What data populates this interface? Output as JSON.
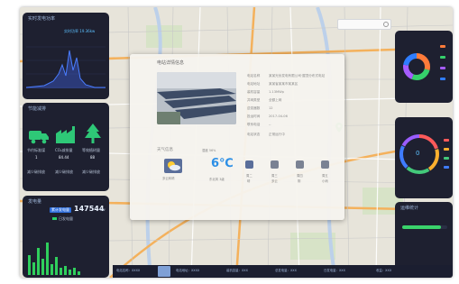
{
  "header": {
    "time": "19:36",
    "year_label": "2024"
  },
  "left_top": {
    "title": "实时发电功率",
    "value_label": "实时功率 19.36kw"
  },
  "left_middle": {
    "title": "节能减排",
    "items": [
      {
        "label": "节约标准煤",
        "value": "1",
        "sub": "减少碳排放"
      },
      {
        "label": "CO₂减排量",
        "value": "84.44",
        "sub": "减少碳排放"
      },
      {
        "label": "等效植树量",
        "value": "88",
        "sub": "减少碳排放"
      }
    ]
  },
  "left_bottom": {
    "title": "发电量",
    "badge": "累计发电量",
    "value": "147544",
    "unit": "kw",
    "legend": "日发电量"
  },
  "popup": {
    "title": "电站详情信息",
    "info": [
      {
        "label": "电站名称",
        "value": "某某光伏发电有限公司·屋顶分布式电站"
      },
      {
        "label": "电站地址",
        "value": "某某省某某市某某区"
      },
      {
        "label": "装机容量",
        "value": "1.13MWp"
      },
      {
        "label": "并网类型",
        "value": "全额上网"
      },
      {
        "label": "逆变器数",
        "value": "12"
      },
      {
        "label": "投运时间",
        "value": "2017-04-06"
      },
      {
        "label": "联系电话",
        "value": "--"
      },
      {
        "label": "电站状态",
        "value": "正常运行中"
      }
    ],
    "weather_title": "天气信息",
    "weather_city": "多云转晴",
    "temperature": "6℃",
    "humidity": "湿度 56%",
    "wind": "东北风 3级",
    "forecast": [
      {
        "day": "周二",
        "desc": "晴"
      },
      {
        "day": "周三",
        "desc": "多云"
      },
      {
        "day": "周四",
        "desc": "阴"
      },
      {
        "day": "周五",
        "desc": "小雨"
      }
    ]
  },
  "right_top": {
    "legend": [
      "组件",
      "逆变器",
      "汇流箱",
      "其他"
    ],
    "colors": [
      "#ff7b3a",
      "#35d06b",
      "#a65cff",
      "#2f7dff"
    ]
  },
  "right_middle": {
    "value": "0",
    "colors": [
      "#ff5a5a",
      "#ffb02e",
      "#43c97a",
      "#3f7cff",
      "#9a5cff"
    ]
  },
  "right_bottom": {
    "title": "运维统计",
    "progress": 0.85
  },
  "bottom_bar": {
    "items": [
      "电站名称：XXXX",
      "电站地址：XXXX",
      "装机容量：XXX",
      "总发电量：XXX",
      "日发电量：XXX",
      "收益：XXX"
    ]
  },
  "icons": {
    "map_pin": "map-pin-icon",
    "weather": "cloud-sun-icon"
  }
}
